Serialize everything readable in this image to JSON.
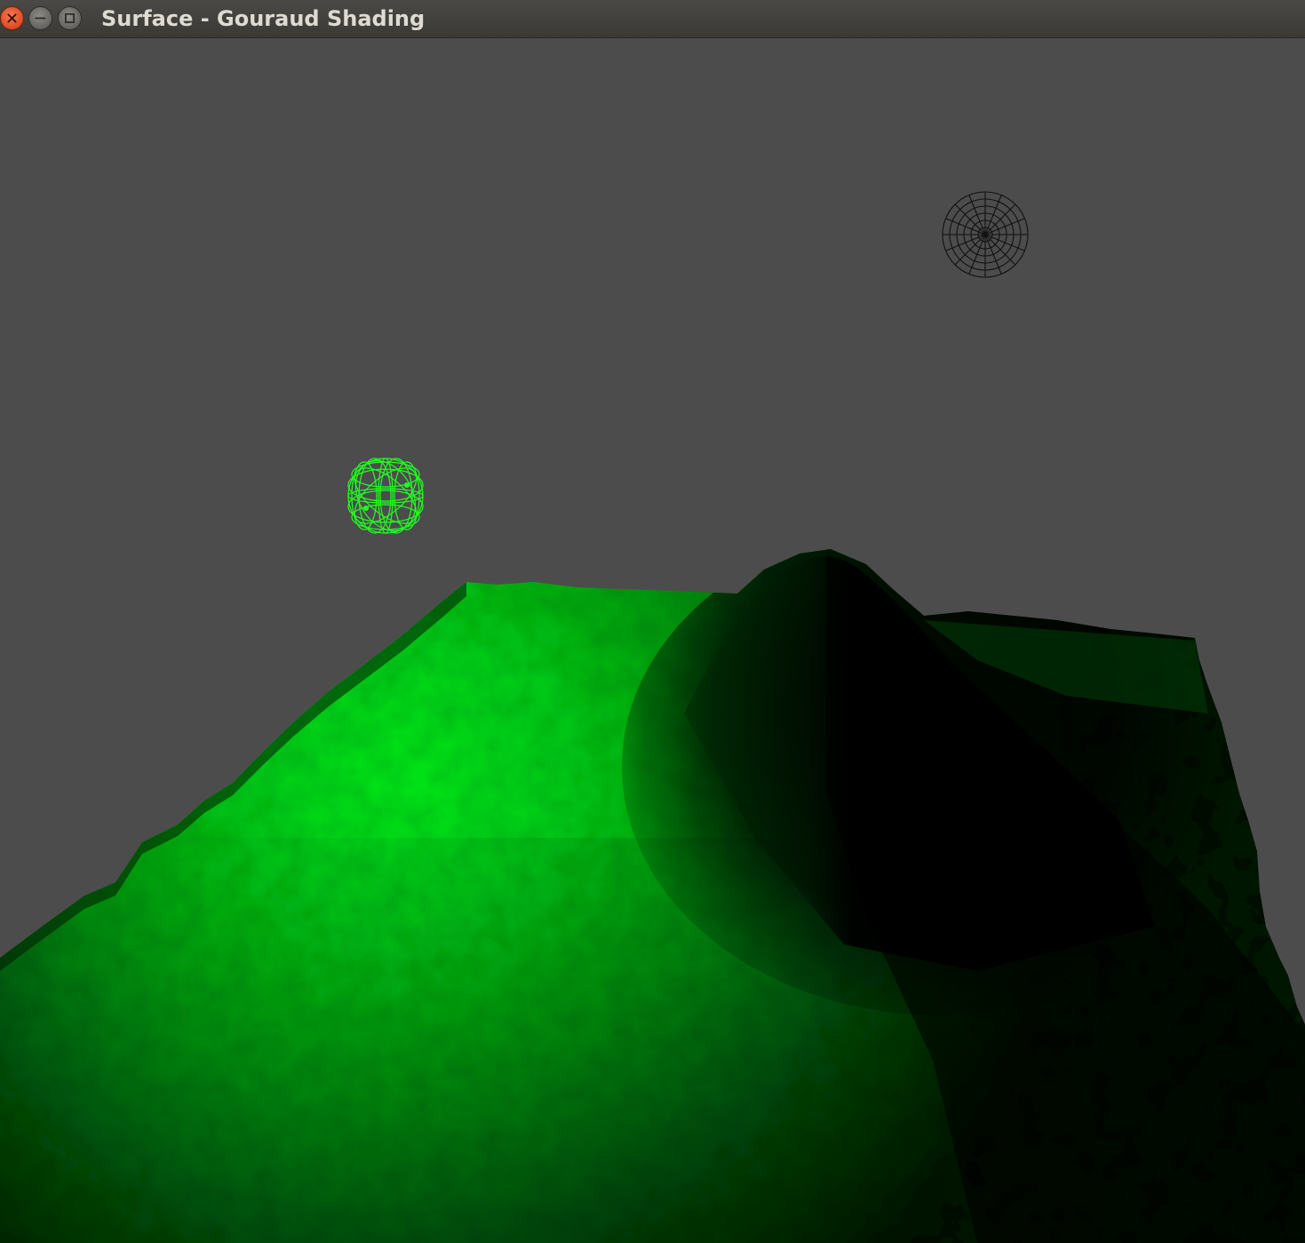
{
  "window": {
    "title": "Surface - Gouraud Shading",
    "close_icon": "close-icon",
    "minimize_icon": "minimize-icon",
    "maximize_icon": "maximize-icon"
  },
  "scene": {
    "background_color": "#4c4c4c",
    "surface_color": "#00e51a",
    "surface_shadow_color": "#000000",
    "light_sphere_color": "#22ff22",
    "dark_sphere_color": "#111111"
  }
}
